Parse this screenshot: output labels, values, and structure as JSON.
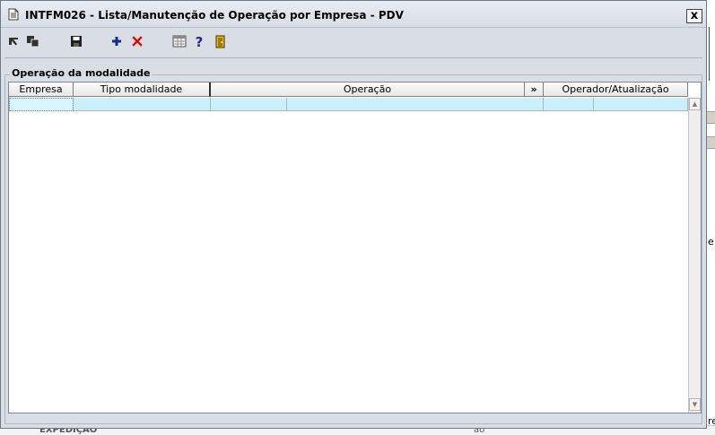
{
  "window": {
    "title": "INTFM026 - Lista/Manutenção de Operação por Empresa - PDV",
    "close_label": "x"
  },
  "toolbar": {
    "items": [
      "first-record-icon",
      "copy-record-icon",
      "save-icon",
      "add-icon",
      "delete-icon",
      "grid-config-icon",
      "help-icon",
      "exit-door-icon"
    ],
    "colors": {
      "add": "#1a2a8a",
      "delete": "#d01010",
      "help": "#1a2a8a",
      "door": "#d8b000"
    }
  },
  "group": {
    "label": "Operação da modalidade"
  },
  "grid": {
    "columns": [
      "Empresa",
      "Tipo modalidade",
      "Operação",
      "»",
      "Operador/Atualização"
    ],
    "row_color": "#cdeffc"
  },
  "background": {
    "right_texts": [
      "e",
      "re"
    ],
    "bottom_texts": [
      "EXPEDIÇÃO",
      "ão"
    ]
  }
}
